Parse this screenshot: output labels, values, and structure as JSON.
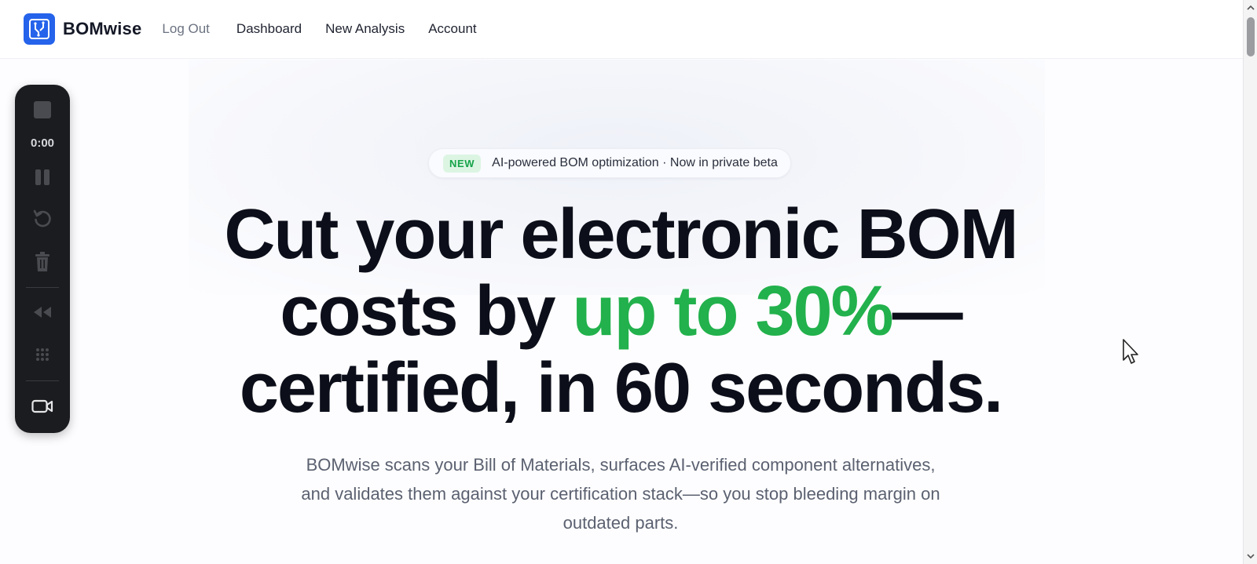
{
  "header": {
    "brand_name": "BOMwise",
    "nav": {
      "logout": "Log Out",
      "dashboard": "Dashboard",
      "new_analysis": "New Analysis",
      "account": "Account"
    }
  },
  "hero": {
    "badge_tag": "NEW",
    "badge_text": "AI-powered BOM optimization · Now in private beta",
    "headline_part1": "Cut your electronic BOM",
    "headline_part2": "costs by ",
    "headline_highlight": "up to 30%",
    "headline_part3": "—",
    "headline_part4": "certified, in 60 seconds.",
    "subtext": "BOMwise scans your Bill of Materials, surfaces AI-verified component alternatives, and validates them against your certification stack—so you stop bleeding margin on outdated parts."
  },
  "recorder": {
    "timer": "0:00",
    "icons": [
      "stop-icon",
      "pause-icon",
      "restart-icon",
      "trash-icon",
      "rewind-icon",
      "grid-icon",
      "camera-icon"
    ]
  },
  "colors": {
    "brand_blue": "#2563eb",
    "accent_green": "#22b14c",
    "recorder_bg": "#1b1c1f"
  }
}
